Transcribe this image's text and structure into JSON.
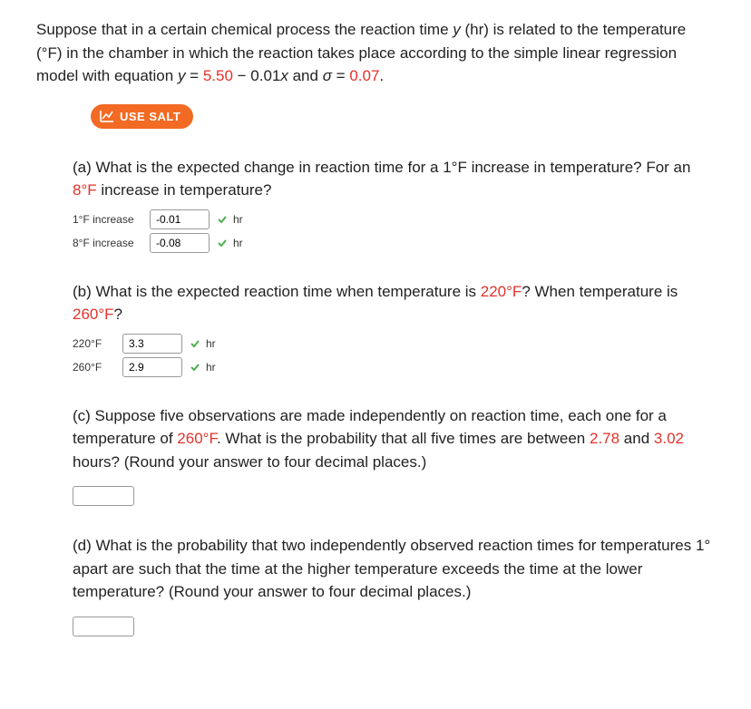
{
  "intro": {
    "line1_pre": " Suppose that in a certain chemical process the reaction time ",
    "var_y": "y",
    "line1_post": " (hr) is related to the temperature (°F) in the chamber in which the reaction takes place according to the simple linear regression model with equation ",
    "eq_lhs": "y",
    "eq_eq": " = ",
    "eq_v1": "5.50",
    "eq_mid": " − 0.01",
    "eq_x": "x",
    "eq_and": " and ",
    "eq_sigma": "σ",
    "eq_eq2": " = ",
    "eq_v2": "0.07",
    "eq_period": "."
  },
  "salt_label": "USE SALT",
  "partA": {
    "prompt_pre": "(a) What is the expected change in reaction time for a 1°F increase in temperature? For an ",
    "prompt_red": "8°F",
    "prompt_post": " increase in temperature?",
    "row1_label": "1°F increase",
    "row1_value": "-0.01",
    "row1_unit": "hr",
    "row2_label": "8°F increase",
    "row2_value": "-0.08",
    "row2_unit": "hr"
  },
  "partB": {
    "prompt_pre": "(b) What is the expected reaction time when temperature is ",
    "prompt_red1": "220°F",
    "prompt_mid": "? When temperature is ",
    "prompt_red2": "260°F",
    "prompt_post": "?",
    "row1_label": "220°F",
    "row1_value": "3.3",
    "row1_unit": "hr",
    "row2_label": "260°F",
    "row2_value": "2.9",
    "row2_unit": "hr"
  },
  "partC": {
    "t1": "(c) Suppose five observations are made independently on reaction time, each one for a temperature of ",
    "r1": "260°F",
    "t2": ". What is the probability that all five times are between ",
    "r2": "2.78",
    "t3": " and ",
    "r3": "3.02",
    "t4": " hours? (Round your answer to four decimal places.)"
  },
  "partD": {
    "text": "(d) What is the probability that two independently observed reaction times for temperatures 1° apart are such that the time at the higher temperature exceeds the time at the lower temperature? (Round your answer to four decimal places.)"
  }
}
